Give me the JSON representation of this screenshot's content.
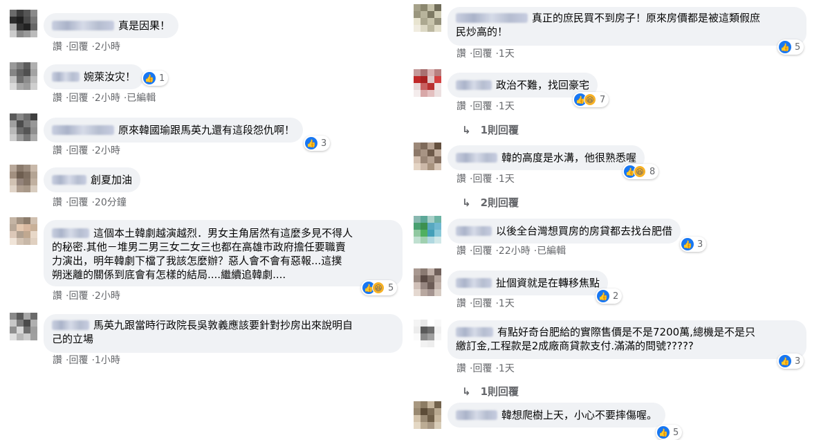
{
  "labels": {
    "like": "讚",
    "reply": "回覆"
  },
  "left": [
    {
      "text": "真是因果！",
      "time": "2小時",
      "edited": ""
    },
    {
      "text": "婉萊汝灾！",
      "time": "2小時",
      "edited": "已編輯",
      "reactions": {
        "count": "1",
        "types": [
          "like"
        ]
      }
    },
    {
      "text": "原來韓國瑜跟馬英九還有這段怨仇啊！",
      "time": "2小時",
      "edited": "",
      "reactions": {
        "count": "3",
        "types": [
          "like"
        ]
      }
    },
    {
      "text": "創夏加油",
      "time": "20分鐘",
      "edited": ""
    },
    {
      "text_lines": [
        "這個本土韓劇越演越烈．男女主角居然有這麼多見不得人",
        "的秘密.其他－堆男二男三女二女三也都在高雄市政府擔任要職賣",
        "力演出，明年韓劇下檔了我該怎麼辦？惡人會不會有惡報...這撲",
        "朔迷離的關係到底會有怎樣的結局....繼續追韓劇...."
      ],
      "time": "2小時",
      "edited": "",
      "reactions": {
        "count": "5",
        "types": [
          "like",
          "haha"
        ]
      }
    },
    {
      "text_lines": [
        "馬英九跟當時行政院長吳敦義應該要針對抄房出來說明自",
        "己的立場"
      ],
      "time": "1小時",
      "edited": ""
    }
  ],
  "right": [
    {
      "text_lines": [
        "真正的庶民買不到房子！原來房價都是被這類假庶",
        "民炒高的！"
      ],
      "time": "1天",
      "edited": "",
      "reactions": {
        "count": "5",
        "types": [
          "like"
        ]
      }
    },
    {
      "text": "政治不難，找回豪宅",
      "time": "1天",
      "edited": "",
      "reactions": {
        "count": "7",
        "types": [
          "like",
          "haha"
        ]
      },
      "replies": "1則回覆"
    },
    {
      "text": "韓的高度是水溝，他很熟悉喔",
      "time": "1天",
      "edited": "",
      "reactions": {
        "count": "8",
        "types": [
          "like",
          "haha"
        ]
      },
      "replies": "2則回覆"
    },
    {
      "text": "以後全台灣想買房的房貸都去找台肥借",
      "time": "22小時",
      "edited": "已編輯",
      "reactions": {
        "count": "3",
        "types": [
          "like"
        ]
      }
    },
    {
      "text": "扯個資就是在轉移焦點",
      "time": "1天",
      "edited": "",
      "reactions": {
        "count": "2",
        "types": [
          "like"
        ]
      }
    },
    {
      "text_lines": [
        "有點好奇台肥給的實際售價是不是7200萬,總機是不是只",
        "繳訂金,工程款是2成廠商貸款支付.滿滿的問號?????"
      ],
      "time": "1天",
      "edited": "",
      "reactions": {
        "count": "3",
        "types": [
          "like"
        ]
      },
      "replies": "1則回覆"
    },
    {
      "text": "韓想爬樹上天，小心不要摔傷喔。",
      "time": "",
      "edited": "",
      "reactions": {
        "count": "5",
        "types": [
          "like"
        ]
      }
    }
  ],
  "colors": {
    "like": "#1877f2",
    "haha": "#f7b125",
    "bubble": "#f0f2f5",
    "meta": "#65676b"
  }
}
